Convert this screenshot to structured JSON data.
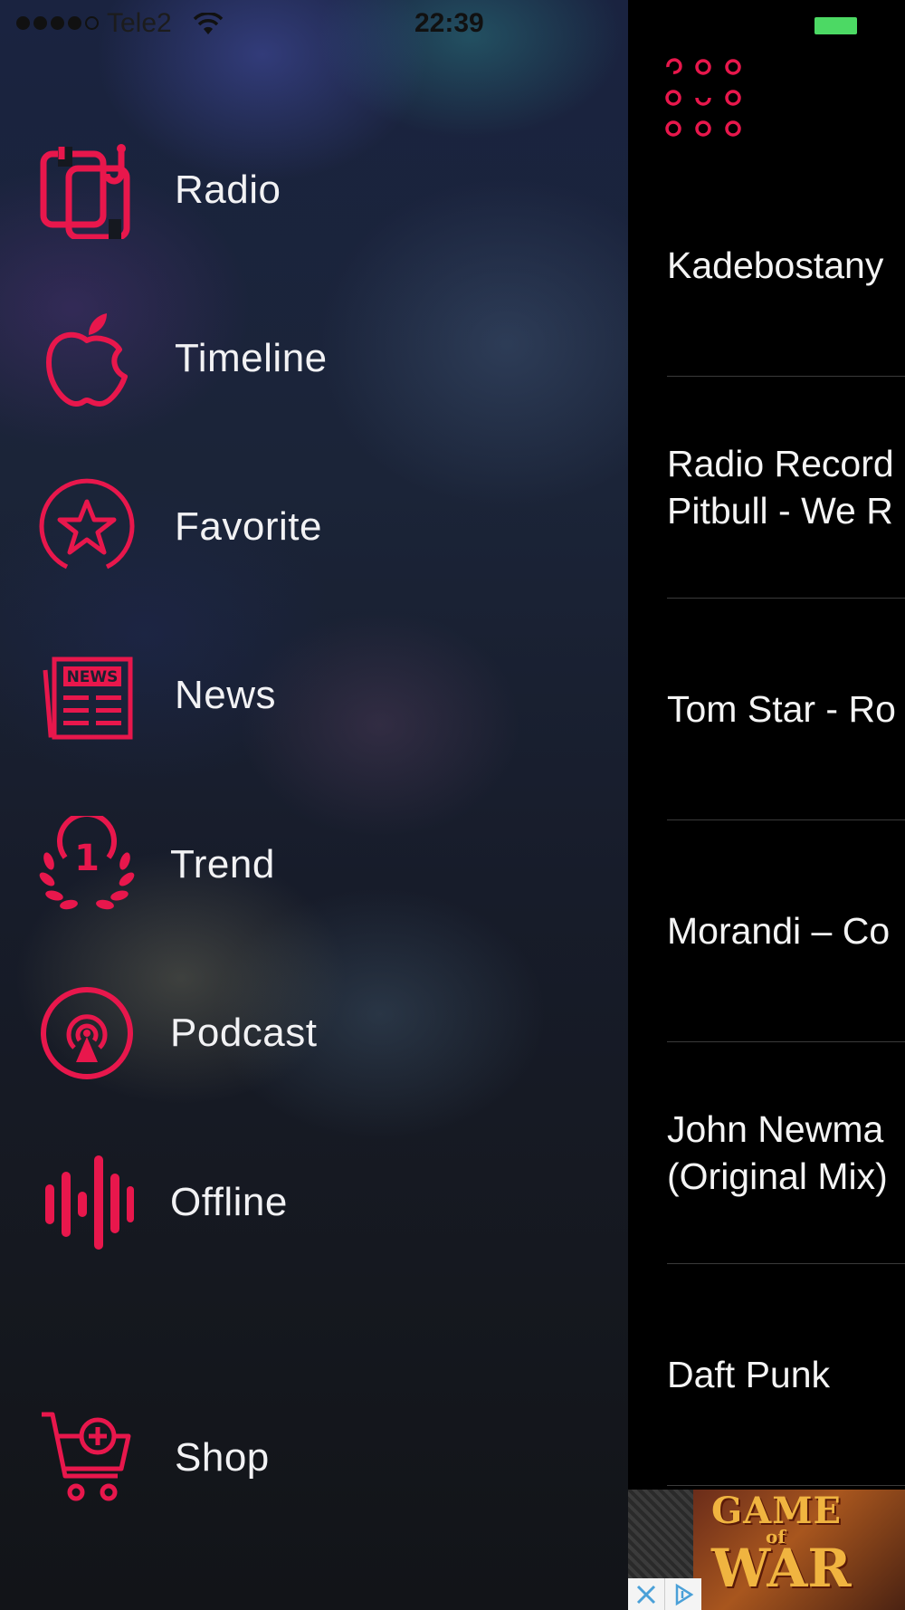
{
  "status_bar": {
    "carrier": "Tele2",
    "time": "22:39",
    "signal_bars_filled": 4,
    "signal_bars_total": 5,
    "icons": [
      "signal-dots-icon",
      "wifi-icon",
      "battery-icon"
    ]
  },
  "menu": {
    "items": [
      {
        "id": "radio",
        "label": "Radio",
        "icon": "radio-app-icon"
      },
      {
        "id": "timeline",
        "label": "Timeline",
        "icon": "apple-icon"
      },
      {
        "id": "favorite",
        "label": "Favorite",
        "icon": "star-icon"
      },
      {
        "id": "news",
        "label": "News",
        "icon": "newspaper-icon",
        "icon_text": "NEWS"
      },
      {
        "id": "trend",
        "label": "Trend",
        "icon": "laurel-number-one-icon",
        "icon_text": "1"
      },
      {
        "id": "podcast",
        "label": "Podcast",
        "icon": "podcast-icon"
      },
      {
        "id": "offline",
        "label": "Offline",
        "icon": "sound-wave-icon"
      },
      {
        "id": "shop",
        "label": "Shop",
        "icon": "cart-add-icon"
      }
    ]
  },
  "tracks": {
    "list": [
      {
        "line1": "Kadebostany",
        "line2": ""
      },
      {
        "line1": "Radio Record",
        "line2": "Pitbull - We R"
      },
      {
        "line1": "Tom Star - Ro",
        "line2": ""
      },
      {
        "line1": "Morandi – Co",
        "line2": ""
      },
      {
        "line1": "John Newma",
        "line2": "(Original Mix)"
      },
      {
        "line1": "Daft Punk",
        "line2": ""
      }
    ]
  },
  "ad": {
    "line1": "GAME",
    "line2": "of",
    "line3": "WAR",
    "icons": [
      "close-ad-icon",
      "adchoices-icon"
    ]
  },
  "colors": {
    "accent": "#e8174c",
    "text": "#f2f2f4",
    "battery": "#4cd964",
    "content_bg": "#000000"
  }
}
